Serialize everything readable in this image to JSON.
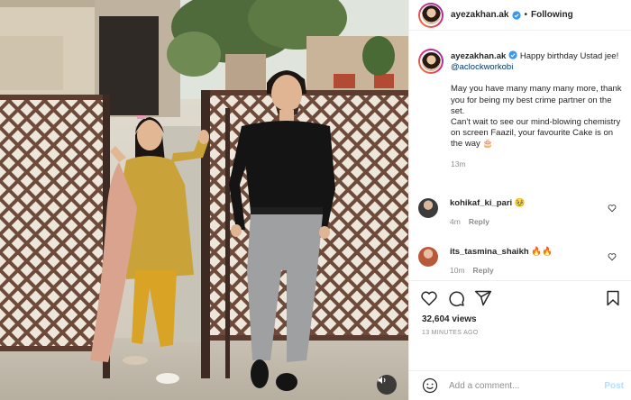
{
  "post": {
    "author": "ayezakhan.ak",
    "follow_status": "Following",
    "separator": "•",
    "caption": {
      "username": "ayezakhan.ak",
      "line1_text": " Happy birthday Ustad jee! ",
      "mention": "@aclockworkobi",
      "paragraph": "May you have many many many more, thank you for being my best crime partner on the set.\nCan't wait to see our mind-blowing chemistry on screen Faazil, your favourite Cake is on the way 🎂",
      "time": "13m"
    },
    "comments": [
      {
        "username": "kohikaf_ki_pari",
        "text": "🥹",
        "time": "4m",
        "reply_label": "Reply",
        "avatar_color": "#3b3b3b"
      },
      {
        "username": "its_tasmina_shaikh",
        "text": "🔥🔥",
        "time": "10m",
        "reply_label": "Reply",
        "avatar_color": "#b85a3a"
      }
    ],
    "views": "32,604 views",
    "time_ago": "13 MINUTES AGO",
    "comment_placeholder": "Add a comment...",
    "post_label": "Post"
  },
  "icons": {
    "verified": "verified-badge-icon",
    "heart": "heart-icon",
    "comment": "comment-icon",
    "share": "share-icon",
    "save": "bookmark-icon",
    "emoji": "emoji-icon",
    "mute": "speaker-icon"
  },
  "colors": {
    "verified_blue": "#3897f0",
    "mention": "#00376b",
    "muted_text": "#8e8e8e",
    "post_disabled": "#b2dffc"
  }
}
